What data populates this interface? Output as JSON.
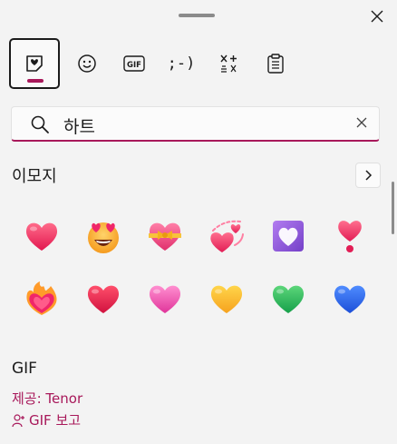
{
  "search": {
    "value": "하트"
  },
  "tabs": [
    {
      "name": "heart-emoji-tab-icon",
      "label": "GIF"
    },
    {
      "gif_label": "GIF",
      "kaomoji_label": ";-)"
    }
  ],
  "toolbar": {
    "gif_label": "GIF",
    "kaomoji_label": ";-)"
  },
  "emoji_section": {
    "title": "이모지"
  },
  "emojis": [
    "red-heart",
    "heart-eyes-face",
    "heart-with-ribbon",
    "revolving-hearts",
    "heart-decoration",
    "heart-exclamation",
    "heart-on-fire",
    "red-heart-2",
    "pink-heart",
    "yellow-heart",
    "green-heart",
    "blue-heart"
  ],
  "gif_section": {
    "title": "GIF",
    "provider": "제공: Tenor",
    "report_label": "GIF 보고"
  },
  "colors": {
    "accent": "#a8185a",
    "link": "#a8185a",
    "background": "#f3f3f3"
  }
}
